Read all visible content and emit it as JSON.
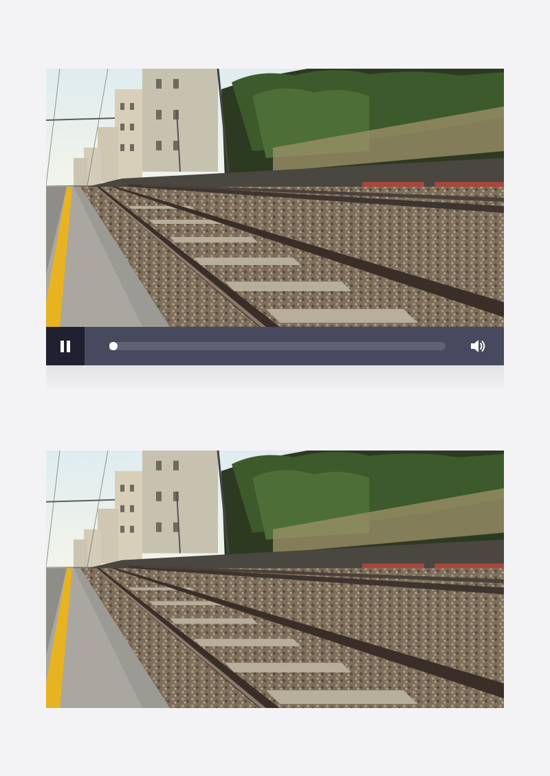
{
  "players": [
    {
      "id": "top",
      "scene": "railway-station-tracks",
      "controls_visible": true,
      "state": "playing",
      "play_button_icon": "pause-icon",
      "volume_icon": "speaker-volume-icon",
      "progress": 0.01
    },
    {
      "id": "bottom",
      "scene": "railway-station-tracks",
      "controls_visible": false
    }
  ],
  "colors": {
    "background": "#f3f3f5",
    "control_bar": "#474a5e",
    "play_button_bg": "#1f2130",
    "progress_track": "#5f6275",
    "thumb": "#ffffff",
    "platform_line": "#e8b320"
  }
}
